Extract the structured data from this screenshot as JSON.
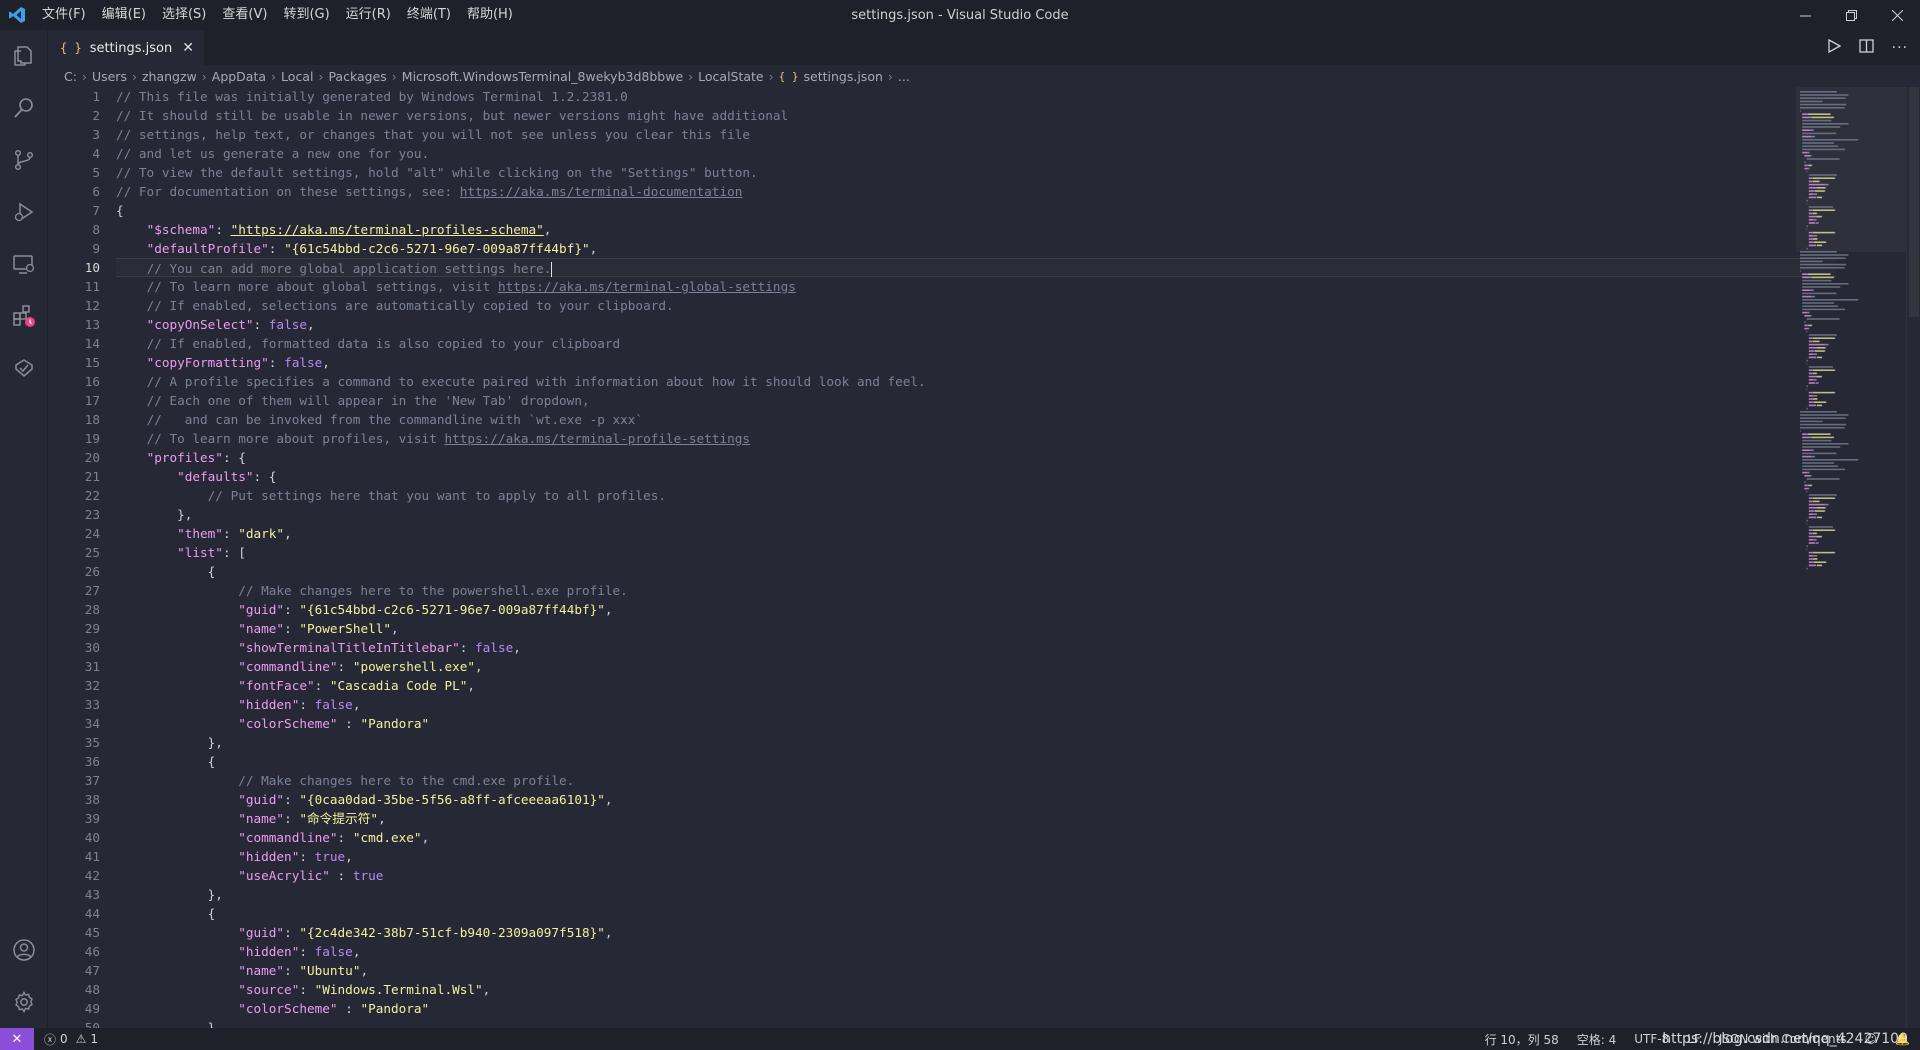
{
  "titlebar": {
    "menu": [
      "文件(F)",
      "编辑(E)",
      "选择(S)",
      "查看(V)",
      "转到(G)",
      "运行(R)",
      "终端(T)",
      "帮助(H)"
    ],
    "title": "settings.json - Visual Studio Code"
  },
  "tabs": [
    {
      "label": "settings.json",
      "icon": "json-file-icon"
    }
  ],
  "breadcrumb": [
    "C:",
    "Users",
    "zhangzw",
    "AppData",
    "Local",
    "Packages",
    "Microsoft.WindowsTerminal_8wekyb3d8bbwe",
    "LocalState",
    "settings.json",
    "..."
  ],
  "editor": {
    "lines": [
      [
        [
          "c",
          "// This file was initially generated by Windows Terminal 1.2.2381.0"
        ]
      ],
      [
        [
          "c",
          "// It should still be usable in newer versions, but newer versions might have additional"
        ]
      ],
      [
        [
          "c",
          "// settings, help text, or changes that you will not see unless you clear this file"
        ]
      ],
      [
        [
          "c",
          "// and let us generate a new one for you."
        ]
      ],
      [
        [
          "c",
          "// To view the default settings, hold \"alt\" while clicking on the \"Settings\" button."
        ]
      ],
      [
        [
          "c",
          "// For documentation on these settings, see: "
        ],
        [
          "cu",
          "https://aka.ms/terminal-documentation"
        ]
      ],
      [
        [
          "b",
          "{"
        ]
      ],
      [
        [
          "b",
          "    "
        ],
        [
          "k",
          "\"$schema\""
        ],
        [
          "b",
          ": "
        ],
        [
          "su",
          "\"https://aka.ms/terminal-profiles-schema\""
        ],
        [
          "b",
          ","
        ]
      ],
      [
        [
          "b",
          "    "
        ],
        [
          "k",
          "\"defaultProfile\""
        ],
        [
          "b",
          ": "
        ],
        [
          "s",
          "\"{61c54bbd-c2c6-5271-96e7-009a87ff44bf}\""
        ],
        [
          "b",
          ","
        ]
      ],
      [
        [
          "b",
          "    "
        ],
        [
          "c",
          "// You can add more global application settings here."
        ]
      ],
      [
        [
          "b",
          "    "
        ],
        [
          "c",
          "// To learn more about global settings, visit "
        ],
        [
          "cu",
          "https://aka.ms/terminal-global-settings"
        ]
      ],
      [
        [
          "b",
          "    "
        ],
        [
          "c",
          "// If enabled, selections are automatically copied to your clipboard."
        ]
      ],
      [
        [
          "b",
          "    "
        ],
        [
          "k",
          "\"copyOnSelect\""
        ],
        [
          "b",
          ": "
        ],
        [
          "kw",
          "false"
        ],
        [
          "b",
          ","
        ]
      ],
      [
        [
          "b",
          "    "
        ],
        [
          "c",
          "// If enabled, formatted data is also copied to your clipboard"
        ]
      ],
      [
        [
          "b",
          "    "
        ],
        [
          "k",
          "\"copyFormatting\""
        ],
        [
          "b",
          ": "
        ],
        [
          "kw",
          "false"
        ],
        [
          "b",
          ","
        ]
      ],
      [
        [
          "b",
          "    "
        ],
        [
          "c",
          "// A profile specifies a command to execute paired with information about how it should look and feel."
        ]
      ],
      [
        [
          "b",
          "    "
        ],
        [
          "c",
          "// Each one of them will appear in the 'New Tab' dropdown,"
        ]
      ],
      [
        [
          "b",
          "    "
        ],
        [
          "c",
          "//   and can be invoked from the commandline with `wt.exe -p xxx`"
        ]
      ],
      [
        [
          "b",
          "    "
        ],
        [
          "c",
          "// To learn more about profiles, visit "
        ],
        [
          "cu",
          "https://aka.ms/terminal-profile-settings"
        ]
      ],
      [
        [
          "b",
          "    "
        ],
        [
          "k",
          "\"profiles\""
        ],
        [
          "b",
          ": {"
        ]
      ],
      [
        [
          "b",
          "        "
        ],
        [
          "k",
          "\"defaults\""
        ],
        [
          "b",
          ": {"
        ]
      ],
      [
        [
          "b",
          "            "
        ],
        [
          "c",
          "// Put settings here that you want to apply to all profiles."
        ]
      ],
      [
        [
          "b",
          "        },"
        ]
      ],
      [
        [
          "b",
          "        "
        ],
        [
          "k",
          "\"them\""
        ],
        [
          "b",
          ": "
        ],
        [
          "s",
          "\"dark\""
        ],
        [
          "b",
          ","
        ]
      ],
      [
        [
          "b",
          "        "
        ],
        [
          "k",
          "\"list\""
        ],
        [
          "b",
          ": ["
        ]
      ],
      [
        [
          "b",
          "            {"
        ]
      ],
      [
        [
          "b",
          "                "
        ],
        [
          "c",
          "// Make changes here to the powershell.exe profile."
        ]
      ],
      [
        [
          "b",
          "                "
        ],
        [
          "k",
          "\"guid\""
        ],
        [
          "b",
          ": "
        ],
        [
          "s",
          "\"{61c54bbd-c2c6-5271-96e7-009a87ff44bf}\""
        ],
        [
          "b",
          ","
        ]
      ],
      [
        [
          "b",
          "                "
        ],
        [
          "k",
          "\"name\""
        ],
        [
          "b",
          ": "
        ],
        [
          "s",
          "\"PowerShell\""
        ],
        [
          "b",
          ","
        ]
      ],
      [
        [
          "b",
          "                "
        ],
        [
          "k",
          "\"showTerminalTitleInTitlebar\""
        ],
        [
          "b",
          ": "
        ],
        [
          "kw",
          "false"
        ],
        [
          "b",
          ","
        ]
      ],
      [
        [
          "b",
          "                "
        ],
        [
          "k",
          "\"commandline\""
        ],
        [
          "b",
          ": "
        ],
        [
          "s",
          "\"powershell.exe\""
        ],
        [
          "b",
          ","
        ]
      ],
      [
        [
          "b",
          "                "
        ],
        [
          "k",
          "\"fontFace\""
        ],
        [
          "b",
          ": "
        ],
        [
          "s",
          "\"Cascadia Code PL\""
        ],
        [
          "b",
          ","
        ]
      ],
      [
        [
          "b",
          "                "
        ],
        [
          "k",
          "\"hidden\""
        ],
        [
          "b",
          ": "
        ],
        [
          "kw",
          "false"
        ],
        [
          "b",
          ","
        ]
      ],
      [
        [
          "b",
          "                "
        ],
        [
          "k",
          "\"colorScheme\""
        ],
        [
          "b",
          " : "
        ],
        [
          "s",
          "\"Pandora\""
        ]
      ],
      [
        [
          "b",
          "            },"
        ]
      ],
      [
        [
          "b",
          "            {"
        ]
      ],
      [
        [
          "b",
          "                "
        ],
        [
          "c",
          "// Make changes here to the cmd.exe profile."
        ]
      ],
      [
        [
          "b",
          "                "
        ],
        [
          "k",
          "\"guid\""
        ],
        [
          "b",
          ": "
        ],
        [
          "s",
          "\"{0caa0dad-35be-5f56-a8ff-afceeeaa6101}\""
        ],
        [
          "b",
          ","
        ]
      ],
      [
        [
          "b",
          "                "
        ],
        [
          "k",
          "\"name\""
        ],
        [
          "b",
          ": "
        ],
        [
          "s",
          "\"命令提示符\""
        ],
        [
          "b",
          ","
        ]
      ],
      [
        [
          "b",
          "                "
        ],
        [
          "k",
          "\"commandline\""
        ],
        [
          "b",
          ": "
        ],
        [
          "s",
          "\"cmd.exe\""
        ],
        [
          "b",
          ","
        ]
      ],
      [
        [
          "b",
          "                "
        ],
        [
          "k",
          "\"hidden\""
        ],
        [
          "b",
          ": "
        ],
        [
          "kw",
          "true"
        ],
        [
          "b",
          ","
        ]
      ],
      [
        [
          "b",
          "                "
        ],
        [
          "k",
          "\"useAcrylic\""
        ],
        [
          "b",
          " : "
        ],
        [
          "kw",
          "true"
        ]
      ],
      [
        [
          "b",
          "            },"
        ]
      ],
      [
        [
          "b",
          "            {"
        ]
      ],
      [
        [
          "b",
          "                "
        ],
        [
          "k",
          "\"guid\""
        ],
        [
          "b",
          ": "
        ],
        [
          "s",
          "\"{2c4de342-38b7-51cf-b940-2309a097f518}\""
        ],
        [
          "b",
          ","
        ]
      ],
      [
        [
          "b",
          "                "
        ],
        [
          "k",
          "\"hidden\""
        ],
        [
          "b",
          ": "
        ],
        [
          "kw",
          "false"
        ],
        [
          "b",
          ","
        ]
      ],
      [
        [
          "b",
          "                "
        ],
        [
          "k",
          "\"name\""
        ],
        [
          "b",
          ": "
        ],
        [
          "s",
          "\"Ubuntu\""
        ],
        [
          "b",
          ","
        ]
      ],
      [
        [
          "b",
          "                "
        ],
        [
          "k",
          "\"source\""
        ],
        [
          "b",
          ": "
        ],
        [
          "s",
          "\"Windows.Terminal.Wsl\""
        ],
        [
          "b",
          ","
        ]
      ],
      [
        [
          "b",
          "                "
        ],
        [
          "k",
          "\"colorScheme\""
        ],
        [
          "b",
          " : "
        ],
        [
          "s",
          "\"Pandora\""
        ]
      ],
      [
        [
          "b",
          "            },"
        ]
      ]
    ],
    "current_line": 10
  },
  "statusbar": {
    "errors": "0",
    "warnings": "1",
    "position": "行 10，列 58",
    "spaces": "空格: 4",
    "encoding": "UTF-8",
    "eol": "LF",
    "language": "JSON with Comments",
    "watermark": "https://blog.csdn.net/qq_42427109"
  },
  "colors": {
    "accent": "#8a4ed8",
    "editor_bg": "#262935",
    "comment": "#7b8196",
    "key": "#ec9bf0",
    "string": "#f3ef9c",
    "keyword": "#b889f4"
  }
}
